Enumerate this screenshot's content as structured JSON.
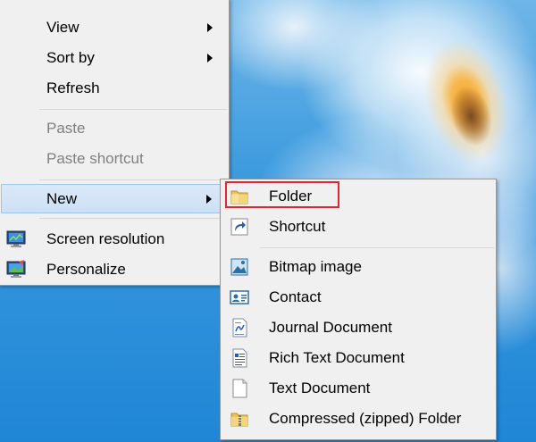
{
  "context_menu": {
    "items": [
      {
        "label": "View",
        "has_submenu": true
      },
      {
        "label": "Sort by",
        "has_submenu": true
      },
      {
        "label": "Refresh"
      },
      {
        "label": "Paste",
        "disabled": true
      },
      {
        "label": "Paste shortcut",
        "disabled": true
      },
      {
        "label": "New",
        "has_submenu": true,
        "highlighted": true
      },
      {
        "label": "Screen resolution",
        "icon": "screen-resolution-icon"
      },
      {
        "label": "Personalize",
        "icon": "personalize-icon"
      }
    ]
  },
  "new_submenu": {
    "items": [
      {
        "label": "Folder",
        "icon": "folder-icon",
        "annotated": true
      },
      {
        "label": "Shortcut",
        "icon": "shortcut-icon"
      },
      {
        "label": "Bitmap image",
        "icon": "bitmap-image-icon"
      },
      {
        "label": "Contact",
        "icon": "contact-card-icon"
      },
      {
        "label": "Journal Document",
        "icon": "journal-document-icon"
      },
      {
        "label": "Rich Text Document",
        "icon": "rich-text-document-icon"
      },
      {
        "label": "Text Document",
        "icon": "text-document-icon"
      },
      {
        "label": "Compressed (zipped) Folder",
        "icon": "zipped-folder-icon"
      }
    ]
  },
  "colors": {
    "highlight_bg": "#cde0f6",
    "highlight_border": "#99c4ee",
    "annotation": "#e0282e",
    "disabled_text": "#7f7f7f",
    "menu_bg": "#f0f0f0"
  }
}
